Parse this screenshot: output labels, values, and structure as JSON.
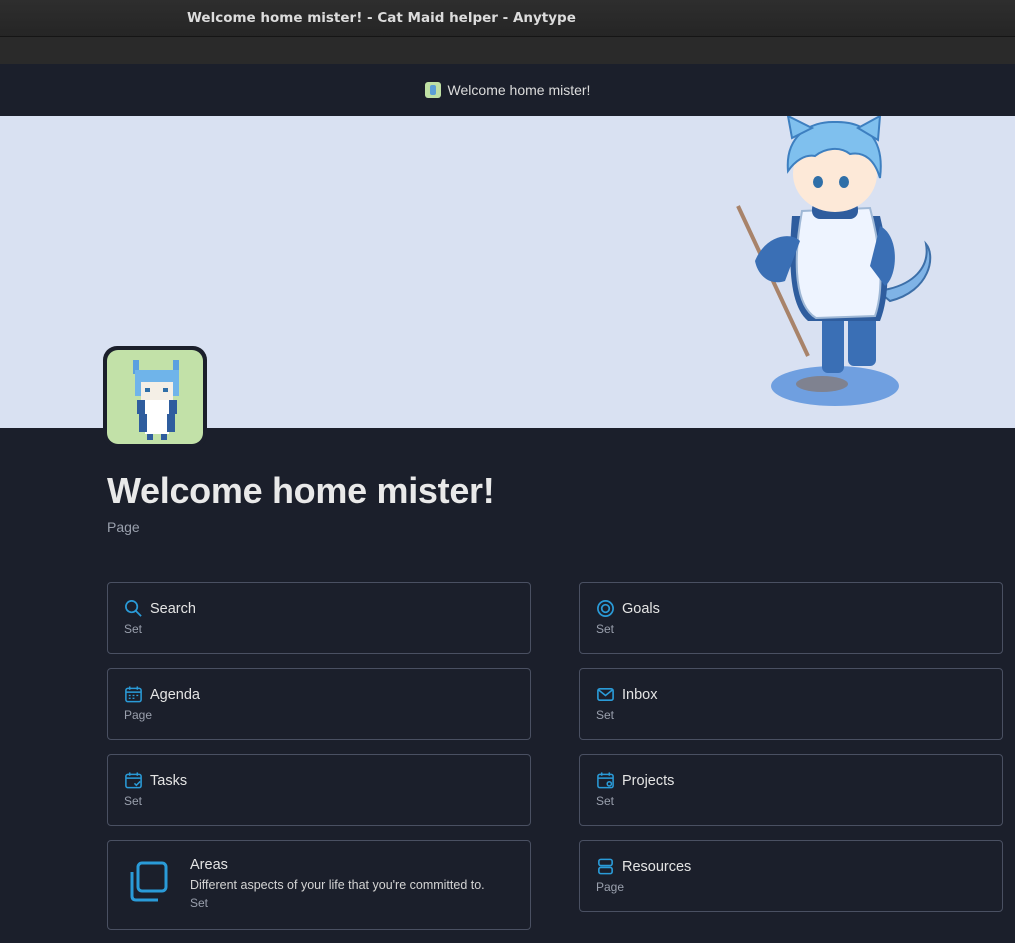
{
  "window": {
    "title": "Welcome home mister! - Cat Maid helper - Anytype"
  },
  "header": {
    "breadcrumb": "Welcome home mister!"
  },
  "page": {
    "title": "Welcome home mister!",
    "type": "Page"
  },
  "colors": {
    "accent": "#2a9bd8",
    "background": "#1b1f2b",
    "cover": "#d9e1f2"
  },
  "links": [
    {
      "title": "Search",
      "type": "Set",
      "icon": "search-icon"
    },
    {
      "title": "Goals",
      "type": "Set",
      "icon": "target-icon"
    },
    {
      "title": "Agenda",
      "type": "Page",
      "icon": "calendar-icon"
    },
    {
      "title": "Inbox",
      "type": "Set",
      "icon": "mail-icon"
    },
    {
      "title": "Tasks",
      "type": "Set",
      "icon": "calendar-check-icon"
    },
    {
      "title": "Projects",
      "type": "Set",
      "icon": "calendar-gear-icon"
    },
    {
      "title": "Areas",
      "type": "Set",
      "description": "Different aspects of your life that you're committed to.",
      "icon": "layers-icon"
    },
    {
      "title": "Resources",
      "type": "Page",
      "icon": "database-icon"
    }
  ]
}
